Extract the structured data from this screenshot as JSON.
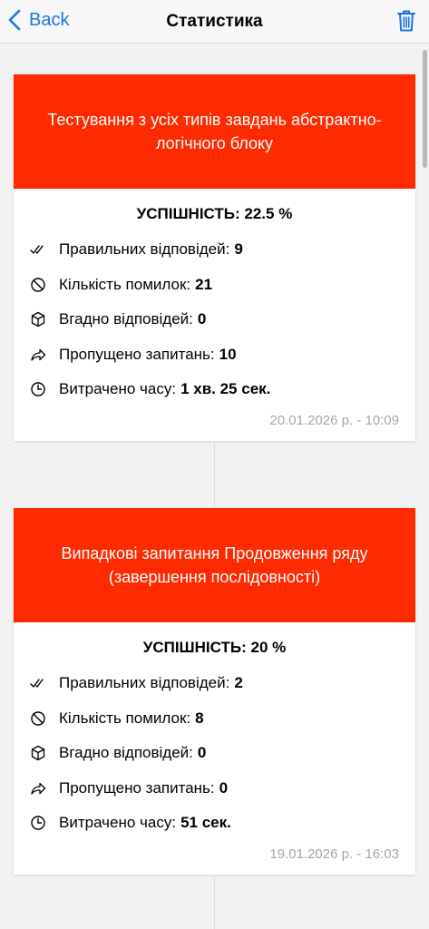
{
  "nav": {
    "back_label": "Back",
    "title": "Статистика"
  },
  "cards": [
    {
      "header": "Тестування з усіх типів завдань абстрактно-логічного блоку",
      "success": "УСПІШНІСТЬ: 22.5 %",
      "rows": [
        {
          "icon": "double-check-icon",
          "label": "Правильних відповідей:",
          "value": "9"
        },
        {
          "icon": "cancel-circle-icon",
          "label": "Кількість помилок:",
          "value": "21"
        },
        {
          "icon": "cube-icon",
          "label": "Вгадно відповідей:",
          "value": "0"
        },
        {
          "icon": "share-arrow-icon",
          "label": "Пропущено запитань:",
          "value": "10"
        },
        {
          "icon": "clock-icon",
          "label": "Витрачено часу:",
          "value": "1 хв. 25 сек."
        }
      ],
      "date": "20.01.2026 р. - 10:09"
    },
    {
      "header": "Випадкові запитання Продовження ряду (завершення послідовності)",
      "success": "УСПІШНІСТЬ: 20 %",
      "rows": [
        {
          "icon": "double-check-icon",
          "label": "Правильних відповідей:",
          "value": "2"
        },
        {
          "icon": "cancel-circle-icon",
          "label": "Кількість помилок:",
          "value": "8"
        },
        {
          "icon": "cube-icon",
          "label": "Вгадно відповідей:",
          "value": "0"
        },
        {
          "icon": "share-arrow-icon",
          "label": "Пропущено запитань:",
          "value": "0"
        },
        {
          "icon": "clock-icon",
          "label": "Витрачено часу:",
          "value": "51 сек."
        }
      ],
      "date": "19.01.2026 р. - 16:03"
    }
  ],
  "colors": {
    "header_bg": "#fe2a00",
    "nav_accent": "#1a73e8"
  }
}
